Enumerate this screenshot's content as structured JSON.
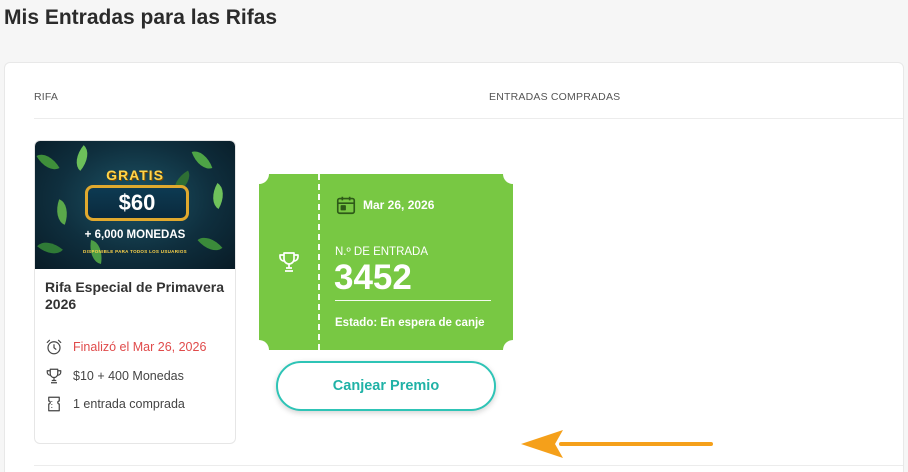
{
  "page": {
    "title": "Mis Entradas para las Rifas"
  },
  "table": {
    "col_raffle": "RIFA",
    "col_entries": "ENTRADAS COMPRADAS"
  },
  "raffle": {
    "banner": {
      "free_text": "GRATIS",
      "amount": "$60",
      "coins": "+ 6,000 MONEDAS",
      "availability": "DISPONIBLE PARA TODOS LOS USUARIOS"
    },
    "title": "Rifa Especial de Primavera 2026",
    "ended_text": "Finalizó el Mar 26, 2026",
    "prize_text": "$10 + 400 Monedas",
    "entries_text": "1 entrada comprada",
    "icons": {
      "ended": "alarm-clock-icon",
      "prize": "trophy-icon",
      "entries": "ticket-icon"
    }
  },
  "ticket": {
    "date": "Mar 26, 2026",
    "entry_label": "N.º DE ENTRADA",
    "entry_number": "3452",
    "status": "Estado: En espera de canje",
    "icons": {
      "date": "calendar-icon",
      "side": "trophy-icon"
    },
    "color": "#78c843"
  },
  "actions": {
    "redeem_label": "Canjear Premio"
  },
  "annotation": {
    "arrow_color": "#f5a01a"
  },
  "colors": {
    "accent": "#2ec4b6",
    "danger": "#e04b4b"
  }
}
